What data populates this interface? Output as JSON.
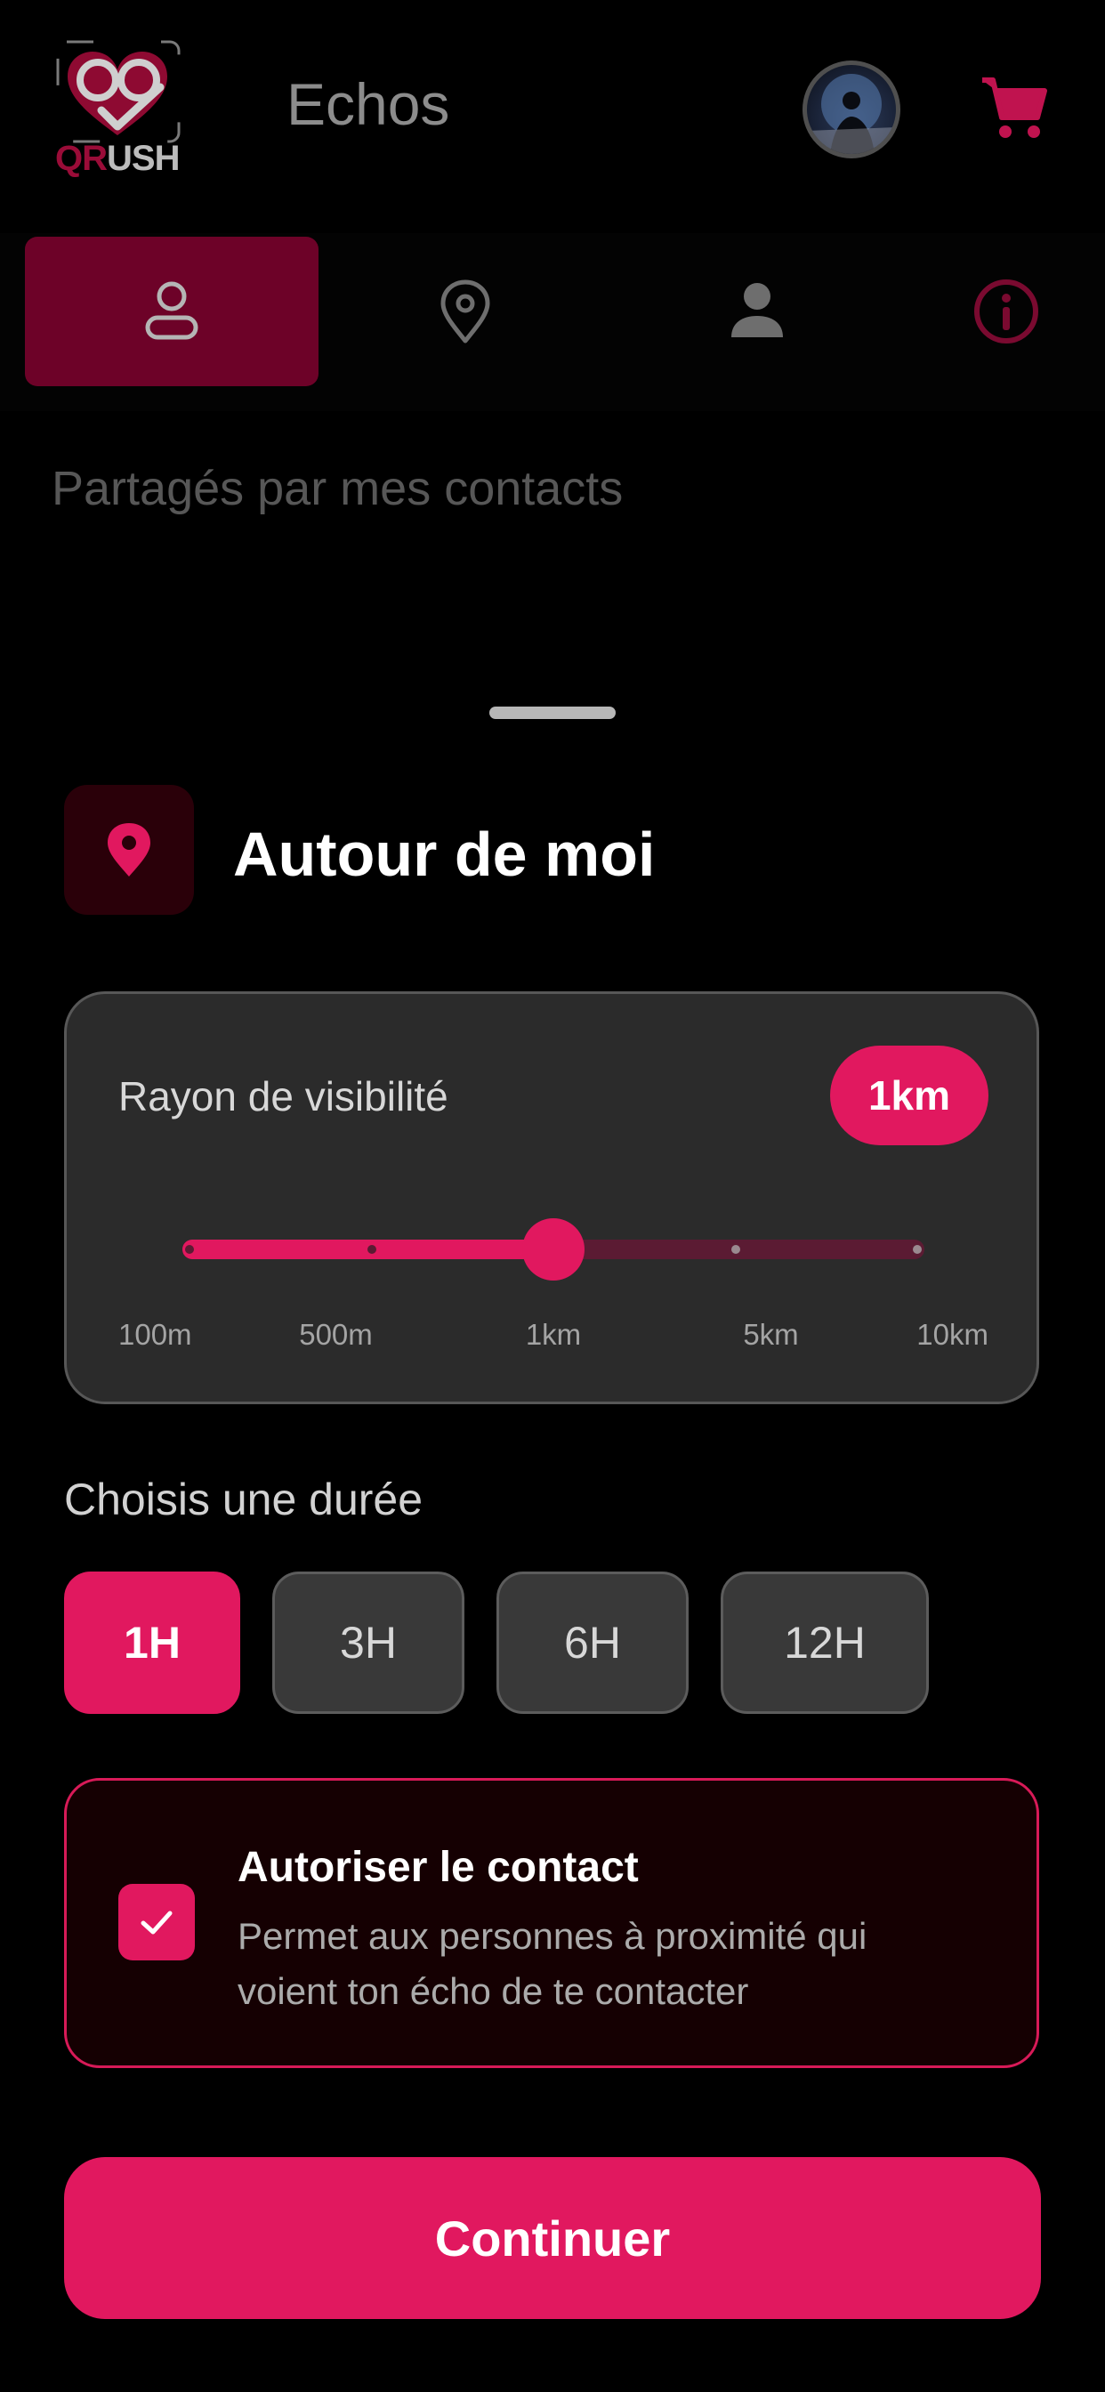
{
  "header": {
    "logo_text": "QRUSH",
    "title": "Echos",
    "avatar_icon": "user-avatar",
    "cart_icon": "shopping-cart-icon"
  },
  "tabs": [
    {
      "icon": "user-outline-icon",
      "active": true
    },
    {
      "icon": "location-pin-outline-icon",
      "active": false
    },
    {
      "icon": "person-filled-icon",
      "active": false
    },
    {
      "icon": "info-circle-icon",
      "active": false
    }
  ],
  "section_hint": "Partagés par mes contacts",
  "sheet": {
    "icon": "location-pin-icon",
    "title": "Autour de moi",
    "radius": {
      "label": "Rayon de visibilité",
      "value": "1km",
      "selected_index": 2,
      "stops": [
        "100m",
        "500m",
        "1km",
        "5km",
        "10km"
      ]
    },
    "duration": {
      "label": "Choisis une durée",
      "options": [
        "1H",
        "3H",
        "6H",
        "12H"
      ],
      "selected": "1H"
    },
    "contact": {
      "checked": true,
      "title": "Autoriser le contact",
      "description": "Permet aux personnes à proximité qui voient ton écho de te contacter"
    },
    "continue_label": "Continuer"
  },
  "colors": {
    "accent": "#e1185f",
    "accent_dark": "#6d0228",
    "background": "#000000",
    "card": "#2b2b2b"
  }
}
